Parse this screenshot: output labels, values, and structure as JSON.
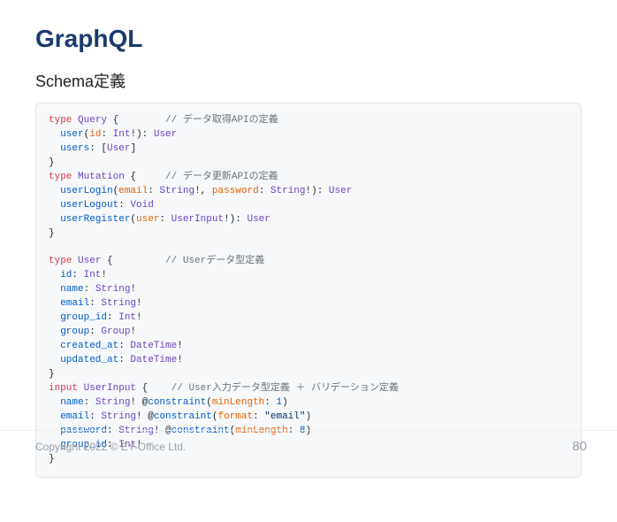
{
  "title": "GraphQL",
  "subtitle": "Schema定義",
  "footer": {
    "copyright": "Copyright 2022 © EY-Office Ltd.",
    "page": "80"
  },
  "code": {
    "lines": [
      [
        [
          "kw",
          "type"
        ],
        [
          "",
          " "
        ],
        [
          "type",
          "Query"
        ],
        [
          "",
          " {        "
        ],
        [
          "cmt",
          "// データ取得APIの定義"
        ]
      ],
      [
        [
          "",
          "  "
        ],
        [
          "fld",
          "user"
        ],
        [
          "",
          "("
        ],
        [
          "var",
          "id"
        ],
        [
          "",
          ": "
        ],
        [
          "type",
          "Int"
        ],
        [
          "",
          "!): "
        ],
        [
          "type",
          "User"
        ]
      ],
      [
        [
          "",
          "  "
        ],
        [
          "fld",
          "users"
        ],
        [
          "",
          ": ["
        ],
        [
          "type",
          "User"
        ],
        [
          "",
          "]"
        ]
      ],
      [
        [
          "",
          "}"
        ]
      ],
      [
        [
          "kw",
          "type"
        ],
        [
          "",
          " "
        ],
        [
          "type",
          "Mutation"
        ],
        [
          "",
          " {     "
        ],
        [
          "cmt",
          "// データ更新APIの定義"
        ]
      ],
      [
        [
          "",
          "  "
        ],
        [
          "fld",
          "userLogin"
        ],
        [
          "",
          "("
        ],
        [
          "var",
          "email"
        ],
        [
          "",
          ": "
        ],
        [
          "type",
          "String"
        ],
        [
          "",
          "!, "
        ],
        [
          "var",
          "password"
        ],
        [
          "",
          ": "
        ],
        [
          "type",
          "String"
        ],
        [
          "",
          "!): "
        ],
        [
          "type",
          "User"
        ]
      ],
      [
        [
          "",
          "  "
        ],
        [
          "fld",
          "userLogout"
        ],
        [
          "",
          ": "
        ],
        [
          "type",
          "Void"
        ]
      ],
      [
        [
          "",
          "  "
        ],
        [
          "fld",
          "userRegister"
        ],
        [
          "",
          "("
        ],
        [
          "var",
          "user"
        ],
        [
          "",
          ": "
        ],
        [
          "type",
          "UserInput"
        ],
        [
          "",
          "!): "
        ],
        [
          "type",
          "User"
        ]
      ],
      [
        [
          "",
          "}"
        ]
      ],
      [
        [
          "",
          ""
        ]
      ],
      [
        [
          "kw",
          "type"
        ],
        [
          "",
          " "
        ],
        [
          "type",
          "User"
        ],
        [
          "",
          " {         "
        ],
        [
          "cmt",
          "// Userデータ型定義"
        ]
      ],
      [
        [
          "",
          "  "
        ],
        [
          "fld",
          "id"
        ],
        [
          "",
          ": "
        ],
        [
          "type",
          "Int"
        ],
        [
          "",
          "!"
        ]
      ],
      [
        [
          "",
          "  "
        ],
        [
          "fld",
          "name"
        ],
        [
          "",
          ": "
        ],
        [
          "type",
          "String"
        ],
        [
          "",
          "!"
        ]
      ],
      [
        [
          "",
          "  "
        ],
        [
          "fld",
          "email"
        ],
        [
          "",
          ": "
        ],
        [
          "type",
          "String"
        ],
        [
          "",
          "!"
        ]
      ],
      [
        [
          "",
          "  "
        ],
        [
          "fld",
          "group_id"
        ],
        [
          "",
          ": "
        ],
        [
          "type",
          "Int"
        ],
        [
          "",
          "!"
        ]
      ],
      [
        [
          "",
          "  "
        ],
        [
          "fld",
          "group"
        ],
        [
          "",
          ": "
        ],
        [
          "type",
          "Group"
        ],
        [
          "",
          "!"
        ]
      ],
      [
        [
          "",
          "  "
        ],
        [
          "fld",
          "created_at"
        ],
        [
          "",
          ": "
        ],
        [
          "type",
          "DateTime"
        ],
        [
          "",
          "!"
        ]
      ],
      [
        [
          "",
          "  "
        ],
        [
          "fld",
          "updated_at"
        ],
        [
          "",
          ": "
        ],
        [
          "type",
          "DateTime"
        ],
        [
          "",
          "!"
        ]
      ],
      [
        [
          "",
          "}"
        ]
      ],
      [
        [
          "kw",
          "input"
        ],
        [
          "",
          " "
        ],
        [
          "type",
          "UserInput"
        ],
        [
          "",
          " {    "
        ],
        [
          "cmt",
          "// User入力データ型定義 ＋ バリデーション定義"
        ]
      ],
      [
        [
          "",
          "  "
        ],
        [
          "fld",
          "name"
        ],
        [
          "",
          ": "
        ],
        [
          "type",
          "String"
        ],
        [
          "",
          "! @"
        ],
        [
          "fld",
          "constraint"
        ],
        [
          "",
          "("
        ],
        [
          "var",
          "minLength"
        ],
        [
          "",
          ": "
        ],
        [
          "fld",
          "1"
        ],
        [
          "",
          ")"
        ]
      ],
      [
        [
          "",
          "  "
        ],
        [
          "fld",
          "email"
        ],
        [
          "",
          ": "
        ],
        [
          "type",
          "String"
        ],
        [
          "",
          "! @"
        ],
        [
          "fld",
          "constraint"
        ],
        [
          "",
          "("
        ],
        [
          "var",
          "format"
        ],
        [
          "",
          ": "
        ],
        [
          "str",
          "\"email\""
        ],
        [
          "",
          ")"
        ]
      ],
      [
        [
          "",
          "  "
        ],
        [
          "fld",
          "password"
        ],
        [
          "",
          ": "
        ],
        [
          "type",
          "String"
        ],
        [
          "",
          "! @"
        ],
        [
          "fld",
          "constraint"
        ],
        [
          "",
          "("
        ],
        [
          "var",
          "minLength"
        ],
        [
          "",
          ": "
        ],
        [
          "fld",
          "8"
        ],
        [
          "",
          ")"
        ]
      ],
      [
        [
          "",
          "  "
        ],
        [
          "fld",
          "group_id"
        ],
        [
          "",
          ": "
        ],
        [
          "type",
          "Int"
        ],
        [
          "",
          "!"
        ]
      ],
      [
        [
          "",
          "}"
        ]
      ]
    ]
  }
}
